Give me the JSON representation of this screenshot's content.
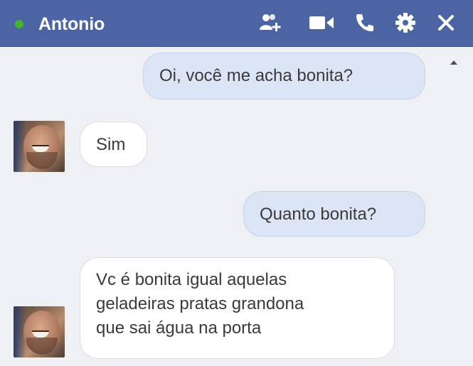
{
  "header": {
    "contact_name": "Antonio",
    "online": true,
    "colors": {
      "bar": "#4b64a4",
      "online_dot": "#42b72a"
    },
    "icons": [
      "add-friend-icon",
      "video-call-icon",
      "phone-icon",
      "gear-icon",
      "close-icon"
    ]
  },
  "messages": [
    {
      "side": "out",
      "text": "Oi, você me acha bonita?"
    },
    {
      "side": "in",
      "text": "Sim"
    },
    {
      "side": "out",
      "text": "Quanto bonita?"
    },
    {
      "side": "in",
      "lines": [
        "Vc é bonita igual aquelas",
        "geladeiras pratas grandona",
        "que sai água na porta"
      ]
    }
  ],
  "colors": {
    "outgoing_bubble": "#dce5f5",
    "incoming_bubble": "#ffffff",
    "background": "#eef0f3"
  }
}
